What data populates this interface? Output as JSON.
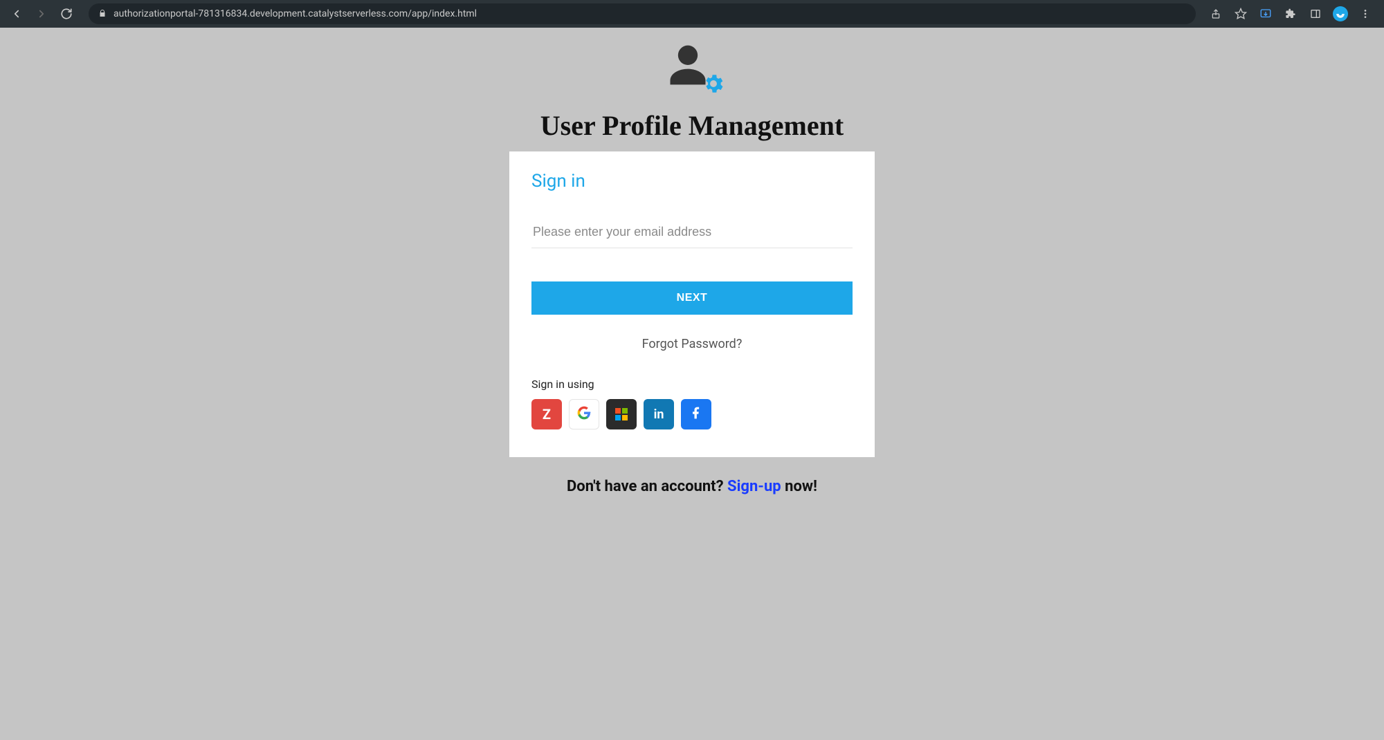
{
  "browser": {
    "url": "authorizationportal-781316834.development.catalystserverless.com/app/index.html"
  },
  "page": {
    "title": "User Profile Management"
  },
  "signin": {
    "heading": "Sign in",
    "email_placeholder": "Please enter your email address",
    "next_label": "NEXT",
    "forgot_label": "Forgot Password?",
    "social_label": "Sign in using",
    "providers": {
      "zoho": "Z",
      "linkedin": "in"
    }
  },
  "signup": {
    "prefix": "Don't have an account? ",
    "link": "Sign-up",
    "suffix": " now!"
  }
}
